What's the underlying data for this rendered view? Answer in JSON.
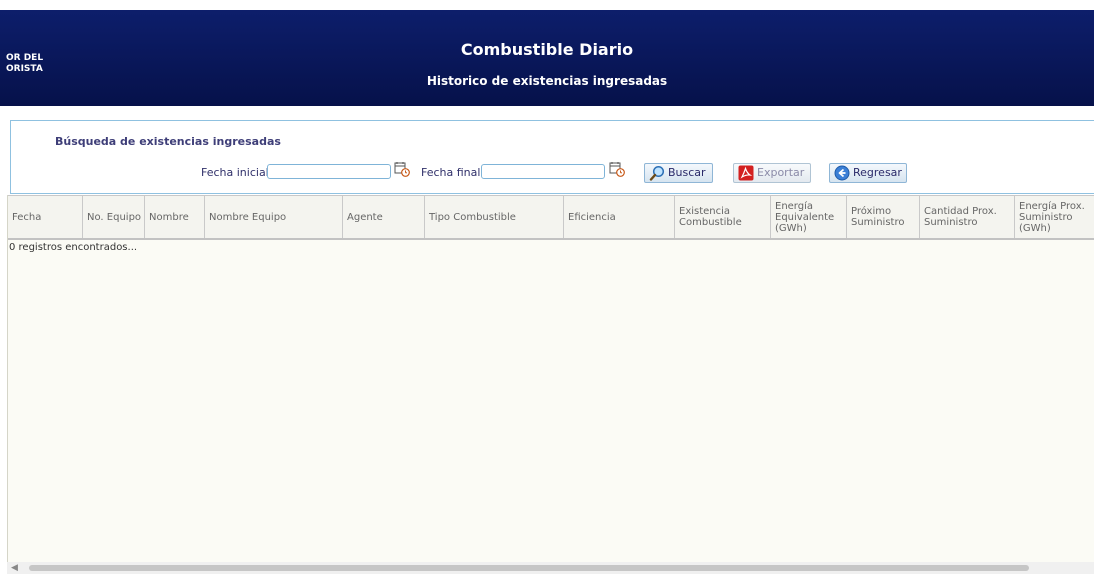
{
  "header": {
    "logo_text": "OR DEL\nORISTA",
    "title": "Combustible Diario",
    "subtitle": "Historico de existencias ingresadas"
  },
  "search": {
    "title": "Búsqueda de existencias ingresadas",
    "fecha_inicial_label": "Fecha inicial",
    "fecha_inicial_value": "",
    "fecha_final_label": "Fecha final",
    "fecha_final_value": "",
    "buscar_label": "Buscar",
    "exportar_label": "Exportar",
    "regresar_label": "Regresar"
  },
  "table": {
    "columns": [
      "Fecha",
      "No. Equipo",
      "Nombre",
      "Nombre Equipo",
      "Agente",
      "Tipo Combustible",
      "Eficiencia",
      "Existencia Combustible",
      "Energía Equivalente (GWh)",
      "Próximo Suministro",
      "Cantidad Prox. Suministro",
      "Energía Prox. Suministro (GWh)"
    ],
    "records_text": "0 registros encontrados..."
  },
  "icons": {
    "calendar": "calendar-icon",
    "buscar": "magnifier-icon",
    "exportar": "pdf-icon",
    "regresar": "back-arrow-icon",
    "scroll_left": "chevron-left-icon"
  },
  "colors": {
    "header_bg": "#06114a",
    "panel_border": "#8fc1e0",
    "label_text": "#30306a",
    "pdf_red": "#d32020",
    "back_blue": "#3b7fd6"
  }
}
